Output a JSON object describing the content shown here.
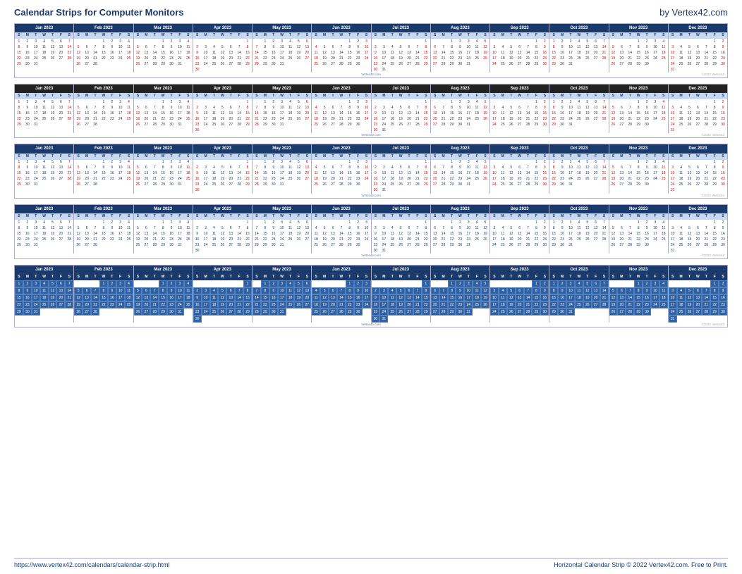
{
  "header": {
    "title": "Calendar Strips for Computer Monitors",
    "brand": "by Vertex42.com"
  },
  "footer": {
    "url": "https://www.vertex42.com/calendars/calendar-strip.html",
    "copyright": "Horizontal Calendar Strip © 2022 Vertex42.com. Free to Print."
  },
  "months": [
    {
      "name": "Jan 2023",
      "startDay": 0,
      "days": 31
    },
    {
      "name": "Feb 2023",
      "startDay": 3,
      "days": 28
    },
    {
      "name": "Mar 2023",
      "startDay": 3,
      "days": 31
    },
    {
      "name": "Apr 2023",
      "startDay": 6,
      "days": 30
    },
    {
      "name": "May 2023",
      "startDay": 1,
      "days": 31
    },
    {
      "name": "Jun 2023",
      "startDay": 4,
      "days": 30
    },
    {
      "name": "Jul 2023",
      "startDay": 6,
      "days": 31
    },
    {
      "name": "Aug 2023",
      "startDay": 2,
      "days": 31
    },
    {
      "name": "Sep 2023",
      "startDay": 5,
      "days": 30
    },
    {
      "name": "Oct 2023",
      "startDay": 0,
      "days": 31
    },
    {
      "name": "Nov 2023",
      "startDay": 3,
      "days": 30
    },
    {
      "name": "Dec 2023",
      "startDay": 5,
      "days": 31
    }
  ],
  "dow": [
    "S",
    "M",
    "T",
    "W",
    "T",
    "F",
    "S"
  ],
  "strips": [
    {
      "style": "style1",
      "showWatermarkCenter": false,
      "showWatermarkRight": true
    },
    {
      "style": "style2",
      "showWatermarkCenter": false,
      "showWatermarkRight": true
    },
    {
      "style": "style3",
      "showWatermarkCenter": false,
      "showWatermarkRight": true
    },
    {
      "style": "style4",
      "showWatermarkCenter": false,
      "showWatermarkRight": true
    },
    {
      "style": "style5",
      "showWatermarkCenter": false,
      "showWatermarkRight": true
    }
  ]
}
